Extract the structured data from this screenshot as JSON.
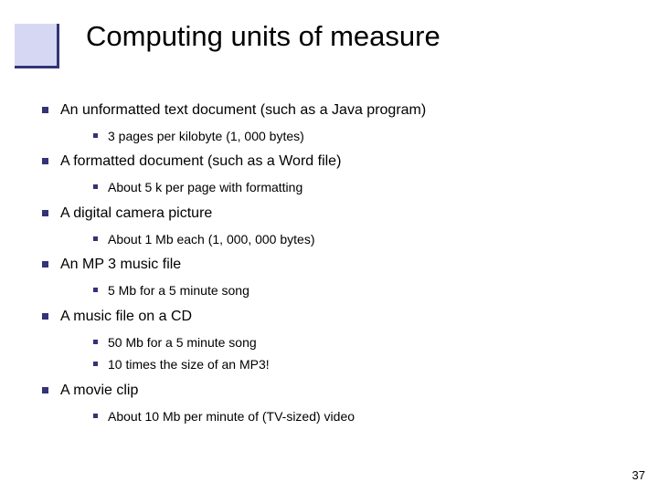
{
  "title": "Computing units of measure",
  "bullets": {
    "b0": {
      "text": "An unformatted text document (such as a Java program)",
      "sub": [
        "3 pages per kilobyte (1, 000 bytes)"
      ]
    },
    "b1": {
      "text": "A formatted document (such as a Word file)",
      "sub": [
        "About 5 k per page with formatting"
      ]
    },
    "b2": {
      "text": "A digital camera picture",
      "sub": [
        "About 1 Mb each (1, 000, 000 bytes)"
      ]
    },
    "b3": {
      "text": "An MP 3 music file",
      "sub": [
        "5 Mb for a 5 minute song"
      ]
    },
    "b4": {
      "text": "A music file on a CD",
      "sub": [
        "50 Mb for a 5 minute song",
        "10 times the size of an MP3!"
      ]
    },
    "b5": {
      "text": "A movie clip",
      "sub": [
        "About 10 Mb per minute of (TV-sized) video"
      ]
    }
  },
  "page_number": "37"
}
